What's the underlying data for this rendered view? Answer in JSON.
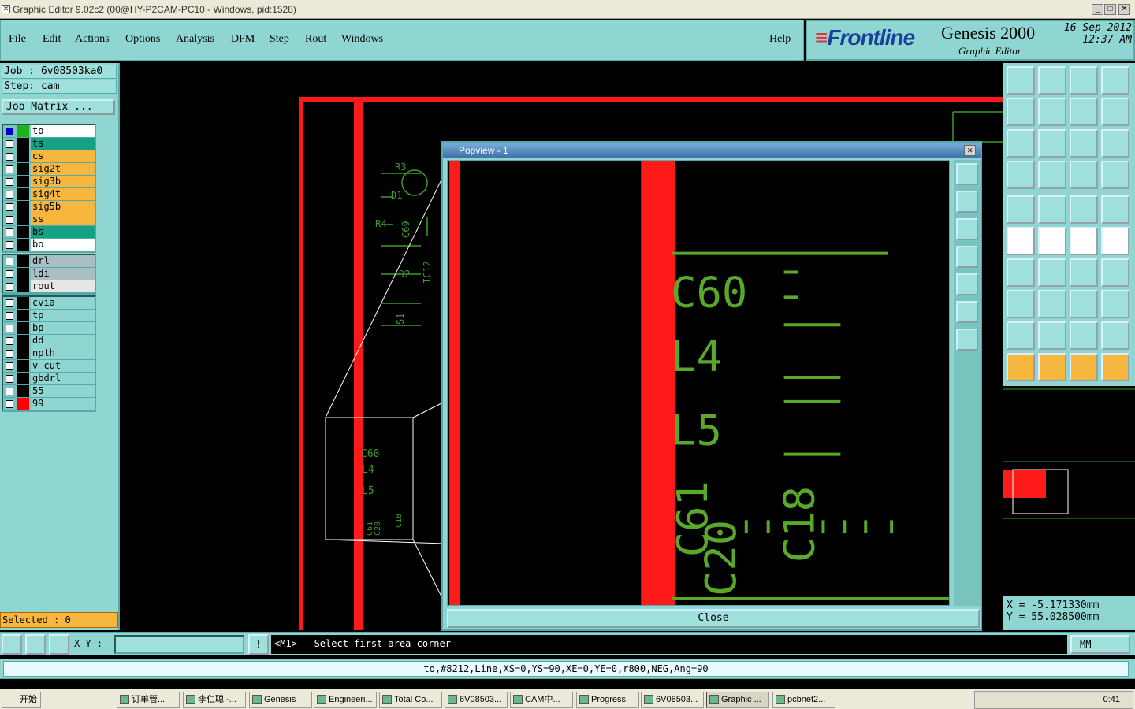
{
  "window": {
    "title": "Graphic Editor 9.02c2 (00@HY-P2CAM-PC10 - Windows, pid:1528)"
  },
  "menu": {
    "file": "File",
    "edit": "Edit",
    "actions": "Actions",
    "options": "Options",
    "analysis": "Analysis",
    "dfm": "DFM",
    "step": "Step",
    "rout": "Rout",
    "windows": "Windows",
    "help": "Help"
  },
  "brand": {
    "logo": "Frontline",
    "product": "Genesis 2000",
    "subtitle": "Graphic Editor",
    "date": "16 Sep 2012",
    "time": "12:37 AM"
  },
  "job": {
    "job_label": "Job : 6v08503ka0",
    "step_label": "Step: cam",
    "matrix_button": "Job Matrix ..."
  },
  "layers_group1": [
    {
      "name": "to",
      "color": "#ffffff",
      "checked": true,
      "swatch": "#1db31d"
    },
    {
      "name": "ts",
      "color": "#16a085",
      "checked": false,
      "swatch": "#000000"
    },
    {
      "name": "cs",
      "color": "#f7b73f",
      "checked": false,
      "swatch": "#000000"
    },
    {
      "name": "sig2t",
      "color": "#f7b73f",
      "checked": false,
      "swatch": "#000000"
    },
    {
      "name": "sig3b",
      "color": "#f7b73f",
      "checked": false,
      "swatch": "#000000"
    },
    {
      "name": "sig4t",
      "color": "#f7b73f",
      "checked": false,
      "swatch": "#000000"
    },
    {
      "name": "sig5b",
      "color": "#f7b73f",
      "checked": false,
      "swatch": "#000000"
    },
    {
      "name": "ss",
      "color": "#f7b73f",
      "checked": false,
      "swatch": "#000000"
    },
    {
      "name": "bs",
      "color": "#16a085",
      "checked": false,
      "swatch": "#000000"
    },
    {
      "name": "bo",
      "color": "#ffffff",
      "checked": false,
      "swatch": "#000000"
    }
  ],
  "layers_group2": [
    {
      "name": "drl",
      "color": "#a9bfc4",
      "checked": false,
      "swatch": "#000000"
    },
    {
      "name": "ldi",
      "color": "#a9bfc4",
      "checked": false,
      "swatch": "#000000"
    },
    {
      "name": "rout",
      "color": "#e6e6e6",
      "checked": false,
      "swatch": "#000000"
    }
  ],
  "layers_group3": [
    {
      "name": "cvia",
      "color": "#8fd6d2",
      "checked": false,
      "swatch": "#000000"
    },
    {
      "name": "tp",
      "color": "#8fd6d2",
      "checked": false,
      "swatch": "#000000"
    },
    {
      "name": "bp",
      "color": "#8fd6d2",
      "checked": false,
      "swatch": "#000000"
    },
    {
      "name": "dd",
      "color": "#8fd6d2",
      "checked": false,
      "swatch": "#000000"
    },
    {
      "name": "npth",
      "color": "#8fd6d2",
      "checked": false,
      "swatch": "#000000"
    },
    {
      "name": "v-cut",
      "color": "#8fd6d2",
      "checked": false,
      "swatch": "#000000"
    },
    {
      "name": "gbdrl",
      "color": "#8fd6d2",
      "checked": false,
      "swatch": "#000000"
    },
    {
      "name": "55",
      "color": "#8fd6d2",
      "checked": false,
      "swatch": "#000000"
    },
    {
      "name": "99",
      "color": "#8fd6d2",
      "checked": false,
      "swatch": "#ff0000"
    }
  ],
  "selected": "Selected : 0",
  "popview": {
    "title": "Popview - 1",
    "close_label": "Close"
  },
  "board_labels": {
    "r3": "R3",
    "d1": "D1",
    "r4": "R4",
    "c69": "C69",
    "d2": "D2",
    "ic12": "IC12",
    "s1": "S1",
    "c60": "C60",
    "l4": "L4",
    "l5": "L5",
    "c61": "C61",
    "c20": "C20",
    "c18": "C18"
  },
  "coords": {
    "x": "X  =  -5.171330mm",
    "y": "Y  =  55.028500mm"
  },
  "status": {
    "xy_label": "X Y :",
    "xy_value": "",
    "prompt": "<M1> - Select first area corner",
    "units": "MM"
  },
  "info_line": "to,#8212,Line,XS=0,YS=90,XE=0,YE=0,r800,NEG,Ang=90",
  "taskbar": {
    "start": "开始",
    "tasks": [
      "订单管...",
      "李仁聪 -...",
      "Genesis",
      "Engineeri...",
      "Total Co...",
      "6V08503...",
      "CAM中...",
      "Progress",
      "6V08503...",
      "Graphic ...",
      "pcbnet2..."
    ],
    "clock": "0:41"
  }
}
